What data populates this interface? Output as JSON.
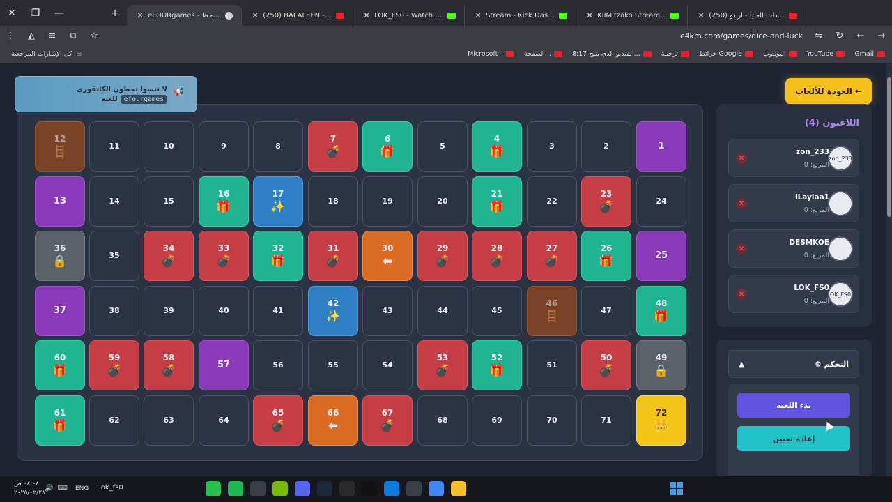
{
  "browser": {
    "tabs": [
      {
        "title": "eFOURgames - ترد وحظ",
        "icon": "app",
        "active": true
      },
      {
        "title": "(250) BALALEEN - بلالين BLVXB",
        "icon": "yt"
      },
      {
        "title": "LOK_FS0 - Watch clips on Kick",
        "icon": "kick"
      },
      {
        "title": "Stream - Kick Dashboard",
        "icon": "kick"
      },
      {
        "title": "KIIMitzako Stream - Watch Live",
        "icon": "kick"
      },
      {
        "title": "(250) القيادات العليا - أر تو YouTube",
        "icon": "yt"
      }
    ],
    "new_tab": "+",
    "url": "e4km.com/games/dice-and-luck",
    "bookmarks": [
      "Gmail",
      "YouTube",
      "اليوتيوب",
      "خرائط Google",
      "ترجمة",
      "8:17 الفيديو الذي يتيح...",
      "الصفحة...",
      "Microsoft –"
    ],
    "bookmarks_all": "كل الإشارات المرجعية"
  },
  "page": {
    "banner": {
      "line1": "لا تنسوا تحطون الكاتقوري",
      "line2": "للعبة",
      "tag": "efourgames"
    },
    "back_button": "العودة للألعاب ←",
    "players_title": "اللاعبون (4)",
    "players": [
      {
        "name": "zon_233",
        "score": "المربع: 0",
        "avatar": "zon_233"
      },
      {
        "name": "lLaylaa1",
        "score": "المربع: 0",
        "avatar": ""
      },
      {
        "name": "DESMKOE",
        "score": "المربع: 0",
        "avatar": ""
      },
      {
        "name": "LOK_FS0",
        "score": "المربع: 0",
        "avatar": "OK_FS0"
      }
    ],
    "control": {
      "title": "⚙ التحكم",
      "toggle": "▲",
      "start": "بدء اللعبة",
      "reset": "إعادة تعيين"
    },
    "board": [
      [
        {
          "n": "12",
          "t": "brown",
          "i": "ladder"
        },
        {
          "n": "11"
        },
        {
          "n": "10"
        },
        {
          "n": "9"
        },
        {
          "n": "8"
        },
        {
          "n": "7",
          "t": "red",
          "i": "bomb"
        },
        {
          "n": "6",
          "t": "green",
          "i": "gift"
        },
        {
          "n": "5"
        },
        {
          "n": "4",
          "t": "green",
          "i": "gift"
        },
        {
          "n": "3"
        },
        {
          "n": "2"
        },
        {
          "n": "1",
          "t": "purple"
        }
      ],
      [
        {
          "n": "13",
          "t": "purple"
        },
        {
          "n": "14"
        },
        {
          "n": "15"
        },
        {
          "n": "16",
          "t": "green",
          "i": "gift"
        },
        {
          "n": "17",
          "t": "blue",
          "i": "sparkle"
        },
        {
          "n": "18"
        },
        {
          "n": "19"
        },
        {
          "n": "20"
        },
        {
          "n": "21",
          "t": "green",
          "i": "gift"
        },
        {
          "n": "22"
        },
        {
          "n": "23",
          "t": "red",
          "i": "bomb"
        },
        {
          "n": "24"
        }
      ],
      [
        {
          "n": "36",
          "t": "gray",
          "i": "lock"
        },
        {
          "n": "35"
        },
        {
          "n": "34",
          "t": "red",
          "i": "bomb"
        },
        {
          "n": "33",
          "t": "red",
          "i": "bomb"
        },
        {
          "n": "32",
          "t": "green",
          "i": "gift"
        },
        {
          "n": "31",
          "t": "red",
          "i": "bomb"
        },
        {
          "n": "30",
          "t": "orange",
          "i": "back"
        },
        {
          "n": "29",
          "t": "red",
          "i": "bomb"
        },
        {
          "n": "28",
          "t": "red",
          "i": "bomb"
        },
        {
          "n": "27",
          "t": "red",
          "i": "bomb"
        },
        {
          "n": "26",
          "t": "green",
          "i": "gift"
        },
        {
          "n": "25",
          "t": "purple"
        }
      ],
      [
        {
          "n": "37",
          "t": "purple"
        },
        {
          "n": "38"
        },
        {
          "n": "39"
        },
        {
          "n": "40"
        },
        {
          "n": "41"
        },
        {
          "n": "42",
          "t": "blue",
          "i": "sparkle"
        },
        {
          "n": "43"
        },
        {
          "n": "44"
        },
        {
          "n": "45"
        },
        {
          "n": "46",
          "t": "brown",
          "i": "ladder"
        },
        {
          "n": "47"
        },
        {
          "n": "48",
          "t": "green",
          "i": "gift"
        }
      ],
      [
        {
          "n": "60",
          "t": "green",
          "i": "gift"
        },
        {
          "n": "59",
          "t": "red",
          "i": "bomb"
        },
        {
          "n": "58",
          "t": "red",
          "i": "bomb"
        },
        {
          "n": "57",
          "t": "purple"
        },
        {
          "n": "56"
        },
        {
          "n": "55"
        },
        {
          "n": "54"
        },
        {
          "n": "53",
          "t": "red",
          "i": "bomb"
        },
        {
          "n": "52",
          "t": "green",
          "i": "gift"
        },
        {
          "n": "51"
        },
        {
          "n": "50",
          "t": "red",
          "i": "bomb"
        },
        {
          "n": "49",
          "t": "gray",
          "i": "lock"
        }
      ],
      [
        {
          "n": "61",
          "t": "green",
          "i": "gift"
        },
        {
          "n": "62"
        },
        {
          "n": "63"
        },
        {
          "n": "64"
        },
        {
          "n": "65",
          "t": "red",
          "i": "bomb"
        },
        {
          "n": "66",
          "t": "orange",
          "i": "back"
        },
        {
          "n": "67",
          "t": "red",
          "i": "bomb"
        },
        {
          "n": "68"
        },
        {
          "n": "69"
        },
        {
          "n": "70"
        },
        {
          "n": "71"
        },
        {
          "n": "72",
          "t": "yellow",
          "i": "crown"
        }
      ]
    ]
  },
  "icons": {
    "bomb": "💣",
    "gift": "🎁",
    "sparkle": "✨",
    "lock": "🔒",
    "ladder": "🪜",
    "back": "⬅",
    "crown": "👑"
  },
  "taskbar": {
    "time": "٠٤:٠٤ ص",
    "date": "٢٠٢٥/٠٢/٢٨",
    "lang": "ENG",
    "user": "lok_fs0"
  }
}
